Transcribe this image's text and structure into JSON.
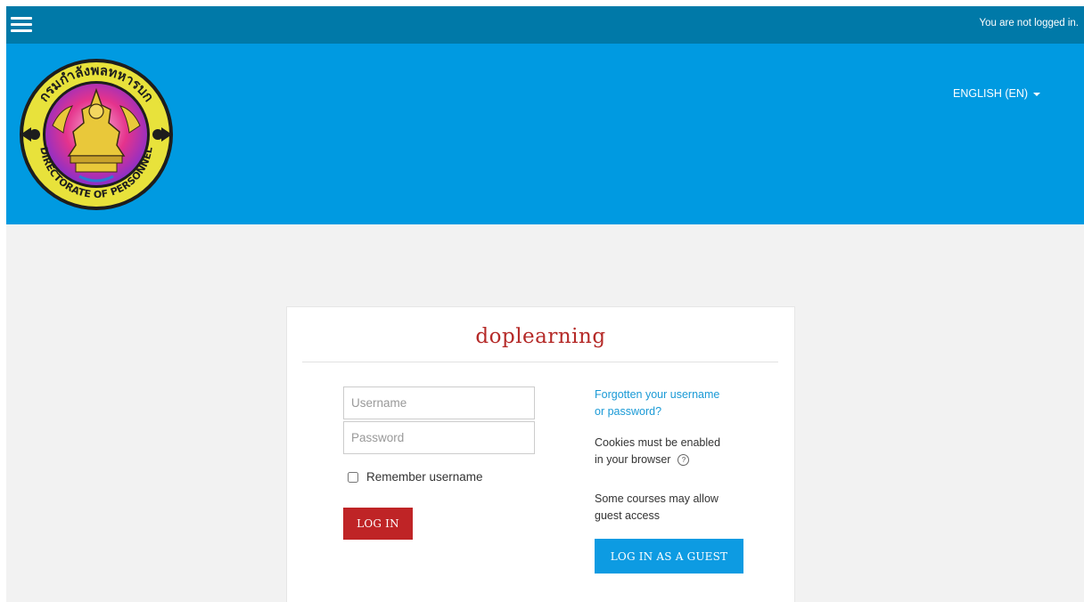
{
  "navbar": {
    "menu_icon": "hamburger-menu-icon",
    "login_status": "You are not logged in."
  },
  "header": {
    "logo_icon": "directorate-of-personnel-seal",
    "language_label": "ENGLISH (EN)"
  },
  "login": {
    "site_title": "doplearning",
    "username_placeholder": "Username",
    "password_placeholder": "Password",
    "remember_label": "Remember username",
    "login_button": "LOG IN",
    "forgot_line1": "Forgotten your username",
    "forgot_line2": "or password?",
    "cookies_line1": "Cookies must be enabled",
    "cookies_line2": "in your browser",
    "help_icon": "question-circle-icon",
    "guest_line1": "Some courses may allow",
    "guest_line2": "guest access",
    "guest_button": "LOG IN AS A GUEST"
  },
  "colors": {
    "navbar": "#0079a8",
    "banner": "#009ae1",
    "title": "#b52a28",
    "login_button": "#bf2426",
    "guest_button": "#0d9be2",
    "link": "#1a9ad6"
  }
}
